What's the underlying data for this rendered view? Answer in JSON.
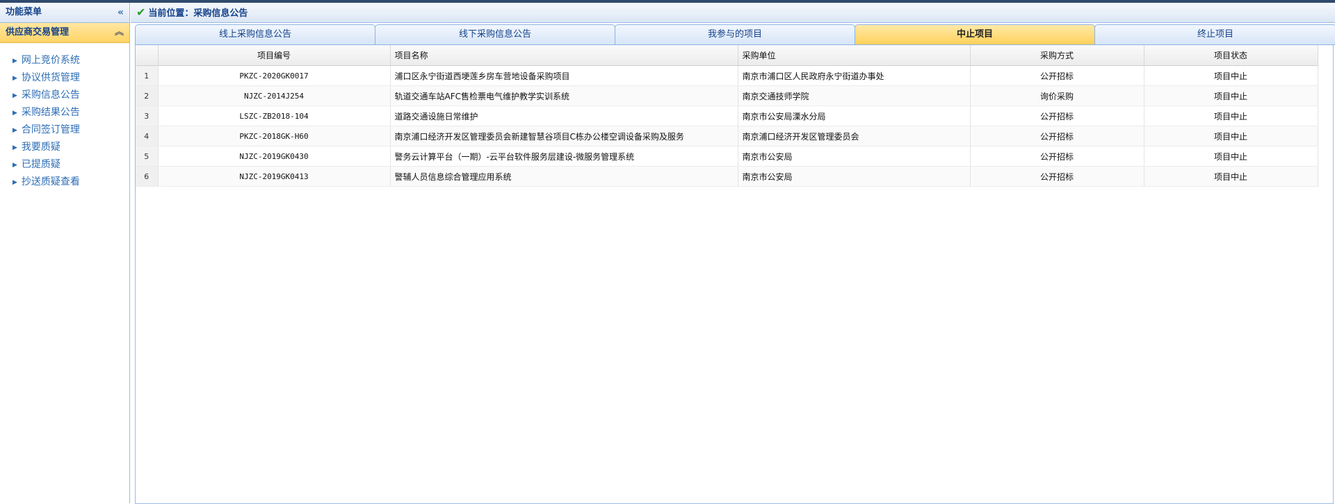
{
  "sidebar": {
    "title": "功能菜单",
    "collapse_icon": "double-chevron-left-icon",
    "group": {
      "title": "供应商交易管理",
      "toggle_icon": "double-chevron-up-icon",
      "items": [
        {
          "label": "网上竞价系统"
        },
        {
          "label": "协议供货管理"
        },
        {
          "label": "采购信息公告"
        },
        {
          "label": "采购结果公告"
        },
        {
          "label": "合同签订管理"
        },
        {
          "label": "我要质疑"
        },
        {
          "label": "已提质疑"
        },
        {
          "label": "抄送质疑查看"
        }
      ]
    }
  },
  "breadcrumb": {
    "icon": "check-icon",
    "text": "当前位置：采购信息公告"
  },
  "tabs": [
    {
      "label": "线上采购信息公告",
      "active": false
    },
    {
      "label": "线下采购信息公告",
      "active": false
    },
    {
      "label": "我参与的项目",
      "active": false
    },
    {
      "label": "中止项目",
      "active": true
    },
    {
      "label": "终止项目",
      "active": false
    }
  ],
  "table": {
    "columns": [
      "",
      "项目编号",
      "项目名称",
      "采购单位",
      "采购方式",
      "项目状态"
    ],
    "rows": [
      {
        "no": "1",
        "code": "PKZC-2020GK0017",
        "name": "浦口区永宁街道西埂莲乡房车营地设备采购项目",
        "unit": "南京市浦口区人民政府永宁街道办事处",
        "method": "公开招标",
        "status": "项目中止"
      },
      {
        "no": "2",
        "code": "NJZC-2014J254",
        "name": "轨道交通车站AFC售检票电气维护教学实训系统",
        "unit": "南京交通技师学院",
        "method": "询价采购",
        "status": "项目中止"
      },
      {
        "no": "3",
        "code": "LSZC-ZB2018-104",
        "name": "道路交通设施日常维护",
        "unit": "南京市公安局溧水分局",
        "method": "公开招标",
        "status": "项目中止"
      },
      {
        "no": "4",
        "code": "PKZC-2018GK-H60",
        "name": "南京浦口经济开发区管理委员会新建智慧谷项目C栋办公楼空调设备采购及服务",
        "unit": "南京浦口经济开发区管理委员会",
        "method": "公开招标",
        "status": "项目中止"
      },
      {
        "no": "5",
        "code": "NJZC-2019GK0430",
        "name": "警务云计算平台（一期）-云平台软件服务层建设-微服务管理系统",
        "unit": "南京市公安局",
        "method": "公开招标",
        "status": "项目中止"
      },
      {
        "no": "6",
        "code": "NJZC-2019GK0413",
        "name": "警辅人员信息综合管理应用系统",
        "unit": "南京市公安局",
        "method": "公开招标",
        "status": "项目中止"
      }
    ]
  },
  "colors": {
    "accent": "#15428b",
    "active_tab": "#ffd15a",
    "link": "#2c6db5"
  }
}
